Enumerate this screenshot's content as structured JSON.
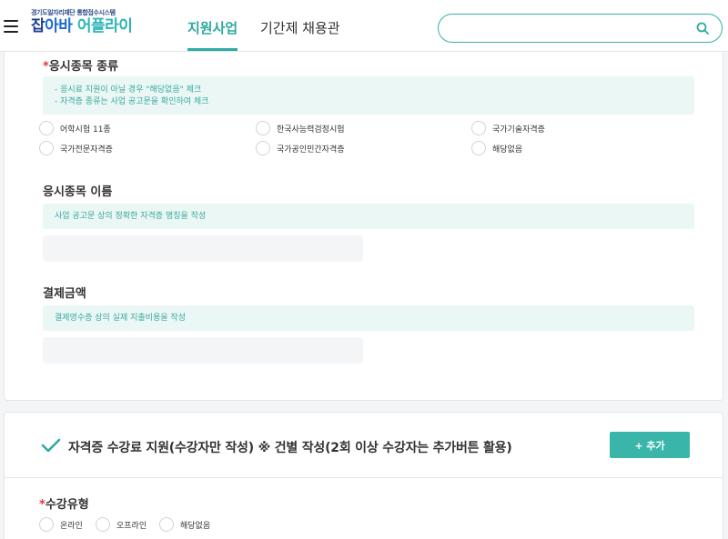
{
  "header": {
    "logo_sub": "경기도일자리재단 통합접수시스템",
    "logo_main_1": "잡",
    "logo_main_2": "아바",
    "logo_main_3": " 어플라이",
    "nav_active": "지원사업",
    "nav_other": "기간제 채용관",
    "search_placeholder": "",
    "menu_icon": "hamburger-menu-icon",
    "search_icon": "search-icon"
  },
  "exam_type": {
    "title": "응시종목 종류",
    "required_mark": "*",
    "info_lines": [
      "- 응시료 지원이 아닐 경우 \"해당없음\" 체크",
      "- 자격증 종류는 사업 공고문을 확인하여 체크"
    ],
    "options": [
      "어학시험 11종",
      "한국사능력검정시험",
      "국가기술자격증",
      "국가전문자격증",
      "국가공인민간자격증",
      "해당없음"
    ]
  },
  "exam_name": {
    "title": "응시종목 이름",
    "info": "사업 공고문 상의 정확한 자격증 명칭을 작성",
    "value": ""
  },
  "payment": {
    "title": "결제금액",
    "info": "결제영수증 상의 실제 지출비용을 작성",
    "value": ""
  },
  "tuition": {
    "check_icon": "check-icon",
    "title": "자격증 수강료 지원(수강자만 작성) ※ 건별 작성(2회 이상 수강자는 추가버튼 활용)",
    "add_button": "+ 추가",
    "type_title": "수강유형",
    "required_mark": "*",
    "type_options": [
      "온라인",
      "오프라인",
      "해당없음"
    ]
  },
  "colors": {
    "accent": "#2eaa9f",
    "info_bg": "#eaf7f5",
    "required": "#e0383e"
  }
}
